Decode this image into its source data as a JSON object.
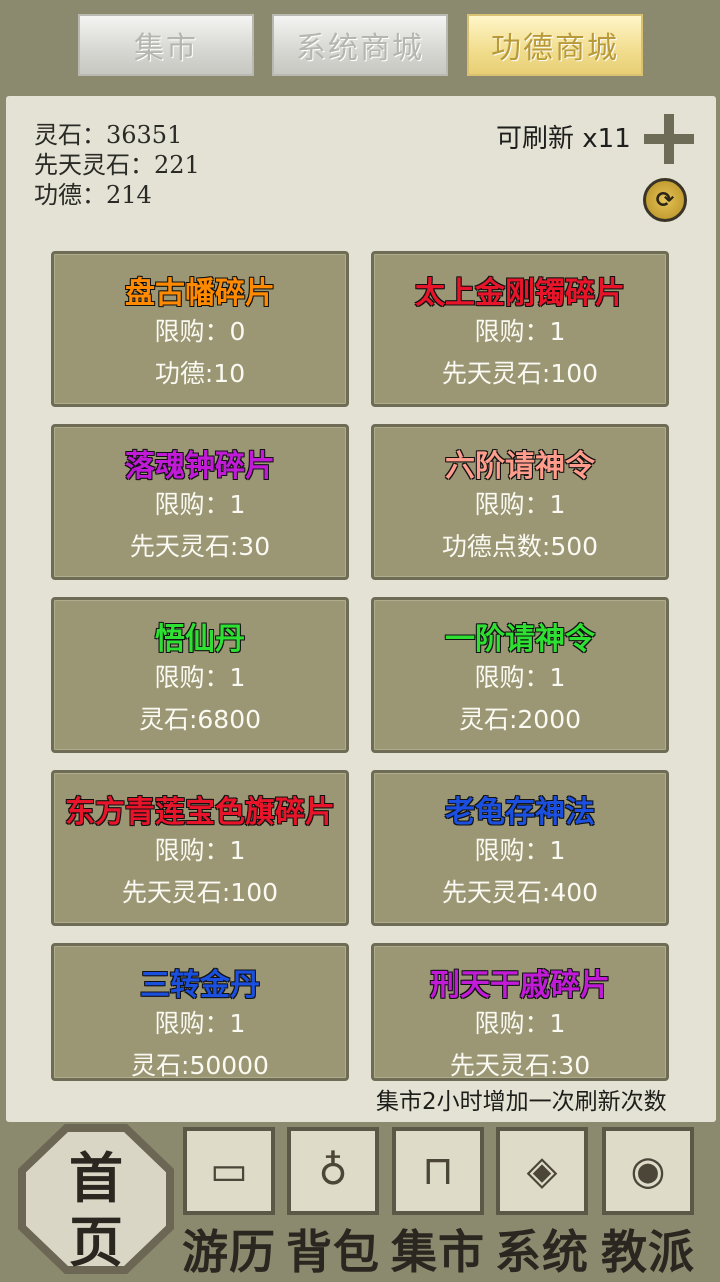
{
  "tabs": [
    {
      "label": "集市",
      "active": false
    },
    {
      "label": "系统商城",
      "active": false
    },
    {
      "label": "功德商城",
      "active": true
    }
  ],
  "resources": {
    "spirit_stone": "灵石：36351",
    "innate_stone": "先天灵石：221",
    "merit": "功德：214"
  },
  "refresh": {
    "label": "可刷新 x11",
    "plus_icon": "plus-icon",
    "refresh_icon": "refresh-icon"
  },
  "items": [
    {
      "name": "盘古幡碎片",
      "color": "#ff8a00",
      "limit": "限购：0",
      "price": "功德:10"
    },
    {
      "name": "太上金刚镯碎片",
      "color": "#e8142a",
      "limit": "限购：1",
      "price": "先天灵石:100"
    },
    {
      "name": "落魂钟碎片",
      "color": "#c21bd8",
      "limit": "限购：1",
      "price": "先天灵石:30"
    },
    {
      "name": "六阶请神令",
      "color": "#ff9c8c",
      "limit": "限购：1",
      "price": "功德点数:500"
    },
    {
      "name": "悟仙丹",
      "color": "#2ee032",
      "limit": "限购：1",
      "price": "灵石:6800"
    },
    {
      "name": "一阶请神令",
      "color": "#2ee032",
      "limit": "限购：1",
      "price": "灵石:2000"
    },
    {
      "name": "东方青莲宝色旗碎片",
      "color": "#e8142a",
      "limit": "限购：1",
      "price": "先天灵石:100"
    },
    {
      "name": "老龟存神法",
      "color": "#1a4fe0",
      "limit": "限购：1",
      "price": "先天灵石:400"
    },
    {
      "name": "三转金丹",
      "color": "#1a4fe0",
      "limit": "限购：1",
      "price": "灵石:50000"
    },
    {
      "name": "刑天干戚碎片",
      "color": "#c21bd8",
      "limit": "限购：1",
      "price": "先天灵石:30"
    }
  ],
  "note": "集市2小时增加一次刷新次数",
  "nav": {
    "home_top": "首",
    "home_bottom": "页",
    "items": [
      {
        "label": "游历",
        "icon": "chest-icon"
      },
      {
        "label": "背包",
        "icon": "bag-icon"
      },
      {
        "label": "集市",
        "icon": "stall-icon"
      },
      {
        "label": "系统",
        "icon": "system-icon"
      },
      {
        "label": "教派",
        "icon": "sect-icon"
      }
    ]
  }
}
